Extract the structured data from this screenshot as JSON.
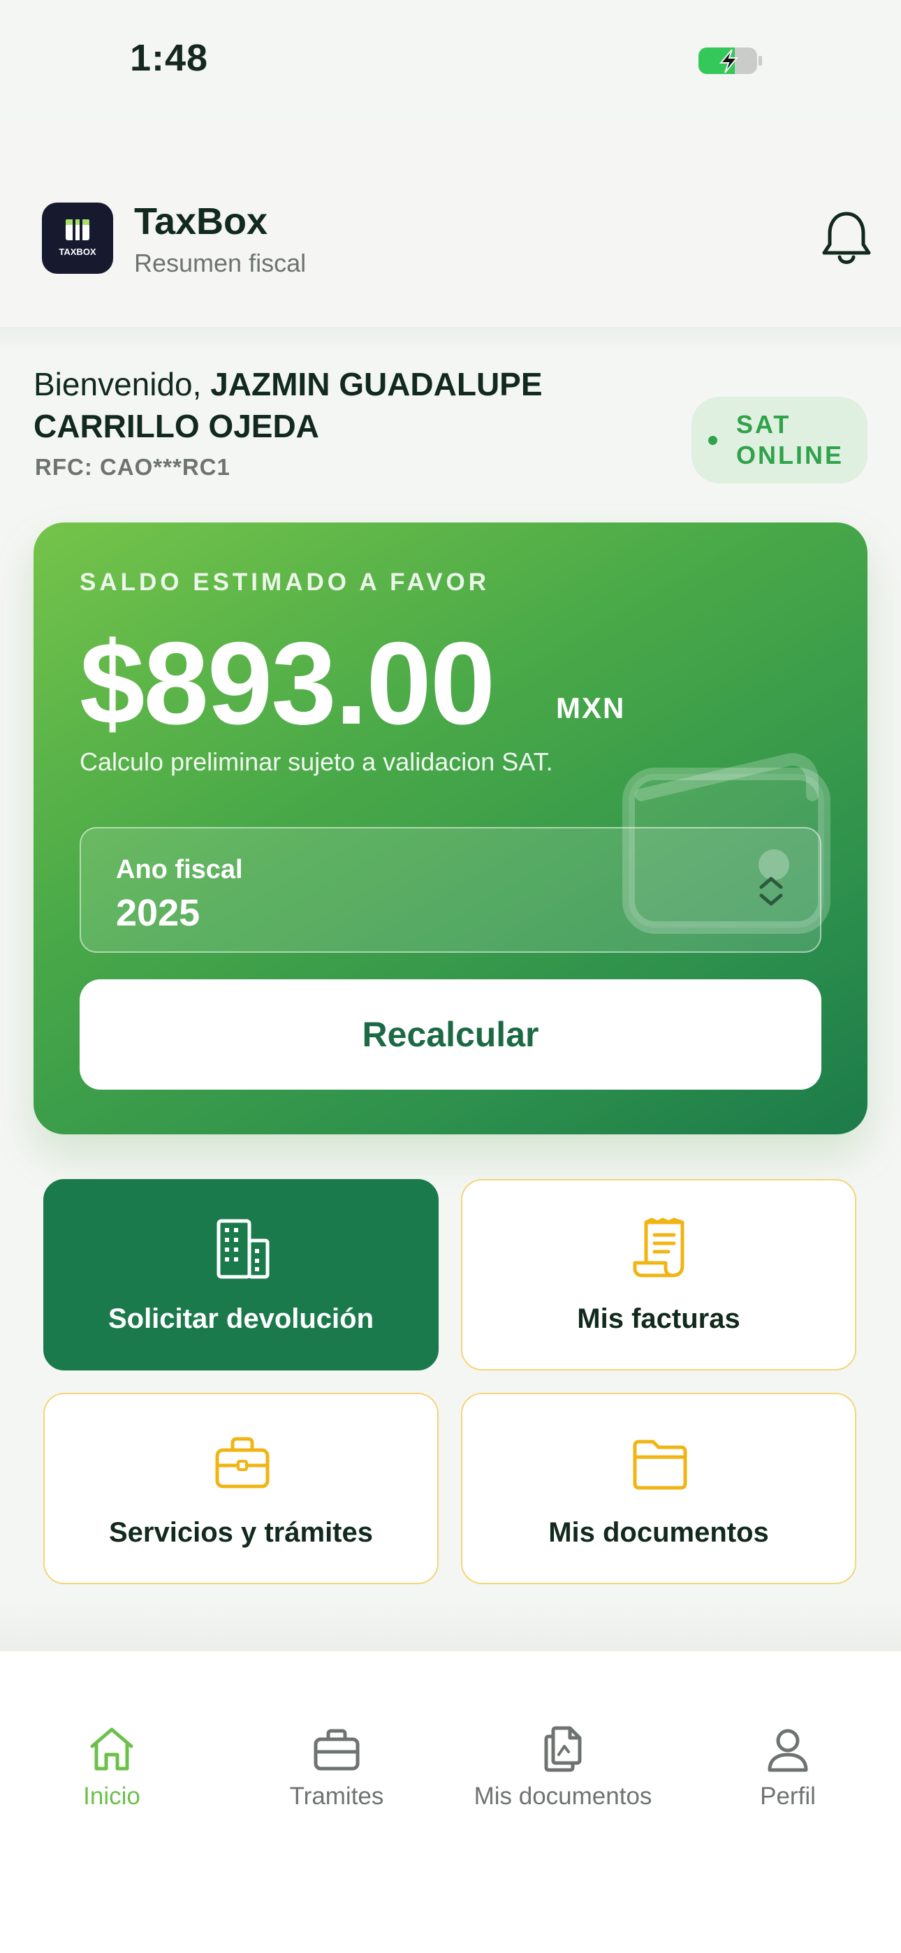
{
  "status_bar": {
    "time": "1:48"
  },
  "header": {
    "logo_text": "TAXBOX",
    "title": "TaxBox",
    "subtitle": "Resumen fiscal",
    "icons": {
      "notifications": "bell-icon"
    }
  },
  "greeting": {
    "prefix": "Bienvenido, ",
    "name": "JAZMIN GUADALUPE CARRILLO OJEDA",
    "rfc": "RFC: CAO***RC1",
    "sat_status_line1": "SAT",
    "sat_status_line2": "ONLINE"
  },
  "balance": {
    "label": "SALDO ESTIMADO A FAVOR",
    "amount": "$893.00",
    "currency": "MXN",
    "note": "Calculo preliminar sujeto a validacion SAT.",
    "fiscal_year_label": "Ano fiscal",
    "fiscal_year_value": "2025",
    "recalc_label": "Recalcular"
  },
  "actions": [
    {
      "label": "Solicitar devolución",
      "icon": "building-icon"
    },
    {
      "label": "Mis facturas",
      "icon": "receipt-icon"
    },
    {
      "label": "Servicios y trámites",
      "icon": "briefcase-icon"
    },
    {
      "label": "Mis documentos",
      "icon": "folder-icon"
    }
  ],
  "nav": [
    {
      "label": "Inicio",
      "icon": "home-icon",
      "active": true
    },
    {
      "label": "Tramites",
      "icon": "briefcase-icon",
      "active": false
    },
    {
      "label": "Mis documentos",
      "icon": "documents-icon",
      "active": false
    },
    {
      "label": "Perfil",
      "icon": "user-icon",
      "active": false
    }
  ],
  "colors": {
    "accent_green": "#6cc04a",
    "primary_dark_green": "#1b7a4c",
    "tile_border_yellow": "#f4d57a",
    "icon_yellow": "#f0b413",
    "sat_green": "#2fa24a"
  }
}
